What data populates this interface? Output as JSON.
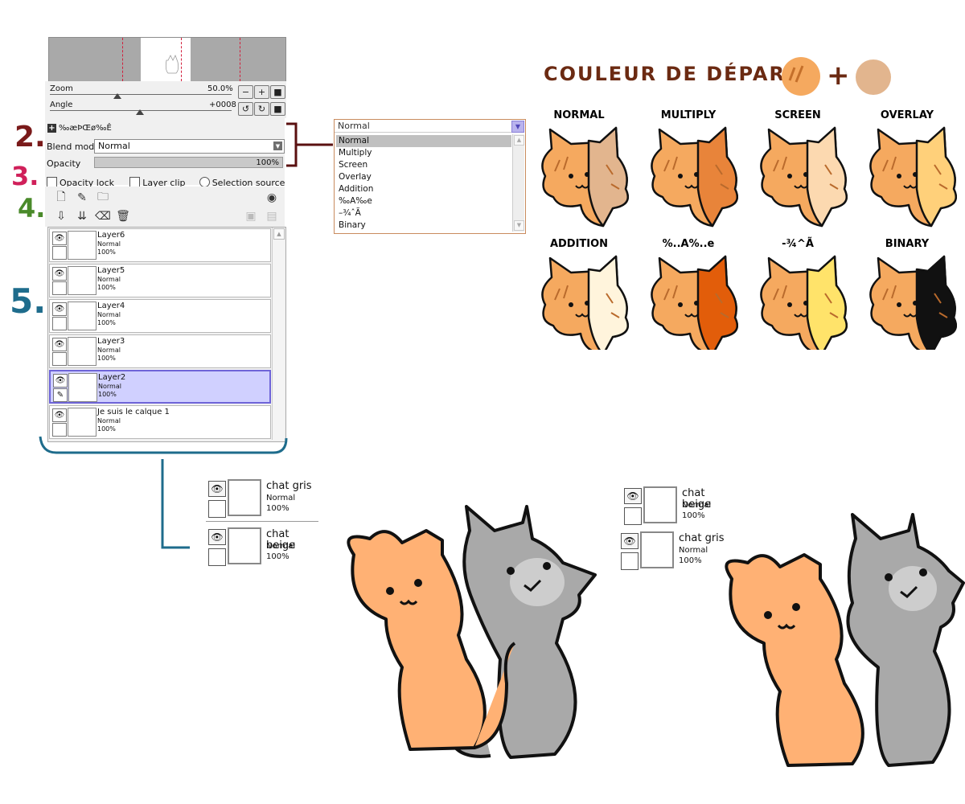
{
  "navigator": {
    "zoom_label": "Zoom",
    "zoom_value": "50.0%",
    "angle_label": "Angle",
    "angle_value": "+0008",
    "zoom_buttons": [
      "minus-icon",
      "plus-icon",
      "reset-icon"
    ],
    "angle_buttons": [
      "rotate-left-icon",
      "rotate-right-icon",
      "reset-icon"
    ]
  },
  "layer_panel": {
    "new_layer_label": "‰æÞŒø‰Ê",
    "blend_mode_label": "Blend mode",
    "blend_mode_value": "Normal",
    "opacity_label": "Opacity",
    "opacity_value": "100%",
    "opacity_lock_label": "Opacity lock",
    "layer_clip_label": "Layer clip",
    "selection_source_label": "Selection source",
    "tools_row1": [
      "new-layer-icon",
      "new-linework-layer-icon",
      "new-folder-icon"
    ],
    "tools_row2": [
      "transfer-down-icon",
      "merge-down-icon",
      "clear-layer-icon",
      "delete-layer-icon"
    ],
    "layers": [
      {
        "name": "Layer6",
        "mode": "Normal",
        "opacity": "100%",
        "selected": false
      },
      {
        "name": "Layer5",
        "mode": "Normal",
        "opacity": "100%",
        "selected": false
      },
      {
        "name": "Layer4",
        "mode": "Normal",
        "opacity": "100%",
        "selected": false
      },
      {
        "name": "Layer3",
        "mode": "Normal",
        "opacity": "100%",
        "selected": false
      },
      {
        "name": "Layer2",
        "mode": "Normal",
        "opacity": "100%",
        "selected": true
      },
      {
        "name": "Je suis le calque 1",
        "mode": "Normal",
        "opacity": "100%",
        "selected": false
      }
    ]
  },
  "dropdown": {
    "current": "Normal",
    "options": [
      "Normal",
      "Multiply",
      "Screen",
      "Overlay",
      "Addition",
      "‰A‰e",
      "–¾ˆÃ",
      "Binary"
    ],
    "highlighted_index": 0
  },
  "annotations": {
    "markers": [
      "2.",
      "3.",
      "4.",
      "5."
    ],
    "marker_colors": [
      "#7a1a1a",
      "#d0205a",
      "#4a8a2a",
      "#1e6c8c"
    ]
  },
  "legend": {
    "title": "COULEUR DE DÉPART :",
    "plus": "+",
    "title_color": "#6b2a12",
    "swatch_colors": [
      "#f5a95f",
      "#e2b58e"
    ],
    "modes": [
      "NORMAL",
      "MULTIPLY",
      "SCREEN",
      "OVERLAY",
      "ADDITION",
      "%..A%..e",
      "-¾^Ã",
      "BINARY"
    ]
  },
  "bottom_left_layers": [
    {
      "name": "chat gris",
      "mode": "Normal",
      "opacity": "100%"
    },
    {
      "name": "chat beige",
      "mode": "Normal",
      "opacity": "100%"
    }
  ],
  "bottom_right_layers": [
    {
      "name": "chat beige",
      "mode": "Normal",
      "opacity": "100%"
    },
    {
      "name": "chat gris",
      "mode": "Normal",
      "opacity": "100%"
    }
  ],
  "colors": {
    "orange_cat": "#ffb174",
    "gray_cat": "#a9a9a9",
    "selection": "#d0d0ff",
    "selection_border": "#6e64d8"
  }
}
